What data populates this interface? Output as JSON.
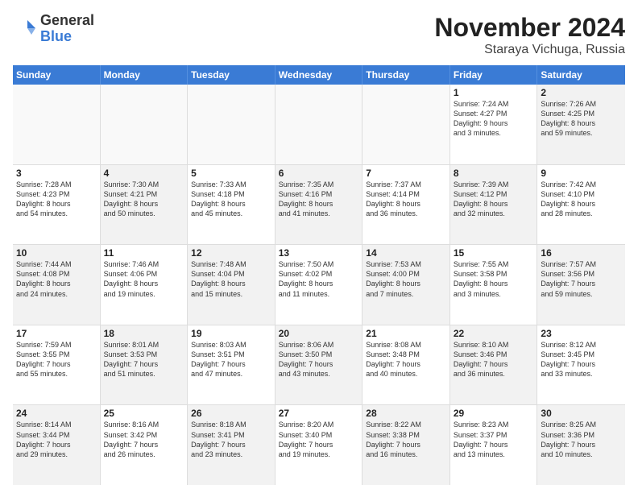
{
  "logo": {
    "general": "General",
    "blue": "Blue"
  },
  "title": "November 2024",
  "subtitle": "Staraya Vichuga, Russia",
  "header_days": [
    "Sunday",
    "Monday",
    "Tuesday",
    "Wednesday",
    "Thursday",
    "Friday",
    "Saturday"
  ],
  "weeks": [
    [
      {
        "day": "",
        "text": "",
        "shaded": true,
        "empty": true
      },
      {
        "day": "",
        "text": "",
        "shaded": true,
        "empty": true
      },
      {
        "day": "",
        "text": "",
        "shaded": true,
        "empty": true
      },
      {
        "day": "",
        "text": "",
        "shaded": true,
        "empty": true
      },
      {
        "day": "",
        "text": "",
        "shaded": true,
        "empty": true
      },
      {
        "day": "1",
        "text": "Sunrise: 7:24 AM\nSunset: 4:27 PM\nDaylight: 9 hours\nand 3 minutes.",
        "shaded": false
      },
      {
        "day": "2",
        "text": "Sunrise: 7:26 AM\nSunset: 4:25 PM\nDaylight: 8 hours\nand 59 minutes.",
        "shaded": true
      }
    ],
    [
      {
        "day": "3",
        "text": "Sunrise: 7:28 AM\nSunset: 4:23 PM\nDaylight: 8 hours\nand 54 minutes.",
        "shaded": false
      },
      {
        "day": "4",
        "text": "Sunrise: 7:30 AM\nSunset: 4:21 PM\nDaylight: 8 hours\nand 50 minutes.",
        "shaded": true
      },
      {
        "day": "5",
        "text": "Sunrise: 7:33 AM\nSunset: 4:18 PM\nDaylight: 8 hours\nand 45 minutes.",
        "shaded": false
      },
      {
        "day": "6",
        "text": "Sunrise: 7:35 AM\nSunset: 4:16 PM\nDaylight: 8 hours\nand 41 minutes.",
        "shaded": true
      },
      {
        "day": "7",
        "text": "Sunrise: 7:37 AM\nSunset: 4:14 PM\nDaylight: 8 hours\nand 36 minutes.",
        "shaded": false
      },
      {
        "day": "8",
        "text": "Sunrise: 7:39 AM\nSunset: 4:12 PM\nDaylight: 8 hours\nand 32 minutes.",
        "shaded": true
      },
      {
        "day": "9",
        "text": "Sunrise: 7:42 AM\nSunset: 4:10 PM\nDaylight: 8 hours\nand 28 minutes.",
        "shaded": false
      }
    ],
    [
      {
        "day": "10",
        "text": "Sunrise: 7:44 AM\nSunset: 4:08 PM\nDaylight: 8 hours\nand 24 minutes.",
        "shaded": true
      },
      {
        "day": "11",
        "text": "Sunrise: 7:46 AM\nSunset: 4:06 PM\nDaylight: 8 hours\nand 19 minutes.",
        "shaded": false
      },
      {
        "day": "12",
        "text": "Sunrise: 7:48 AM\nSunset: 4:04 PM\nDaylight: 8 hours\nand 15 minutes.",
        "shaded": true
      },
      {
        "day": "13",
        "text": "Sunrise: 7:50 AM\nSunset: 4:02 PM\nDaylight: 8 hours\nand 11 minutes.",
        "shaded": false
      },
      {
        "day": "14",
        "text": "Sunrise: 7:53 AM\nSunset: 4:00 PM\nDaylight: 8 hours\nand 7 minutes.",
        "shaded": true
      },
      {
        "day": "15",
        "text": "Sunrise: 7:55 AM\nSunset: 3:58 PM\nDaylight: 8 hours\nand 3 minutes.",
        "shaded": false
      },
      {
        "day": "16",
        "text": "Sunrise: 7:57 AM\nSunset: 3:56 PM\nDaylight: 7 hours\nand 59 minutes.",
        "shaded": true
      }
    ],
    [
      {
        "day": "17",
        "text": "Sunrise: 7:59 AM\nSunset: 3:55 PM\nDaylight: 7 hours\nand 55 minutes.",
        "shaded": false
      },
      {
        "day": "18",
        "text": "Sunrise: 8:01 AM\nSunset: 3:53 PM\nDaylight: 7 hours\nand 51 minutes.",
        "shaded": true
      },
      {
        "day": "19",
        "text": "Sunrise: 8:03 AM\nSunset: 3:51 PM\nDaylight: 7 hours\nand 47 minutes.",
        "shaded": false
      },
      {
        "day": "20",
        "text": "Sunrise: 8:06 AM\nSunset: 3:50 PM\nDaylight: 7 hours\nand 43 minutes.",
        "shaded": true
      },
      {
        "day": "21",
        "text": "Sunrise: 8:08 AM\nSunset: 3:48 PM\nDaylight: 7 hours\nand 40 minutes.",
        "shaded": false
      },
      {
        "day": "22",
        "text": "Sunrise: 8:10 AM\nSunset: 3:46 PM\nDaylight: 7 hours\nand 36 minutes.",
        "shaded": true
      },
      {
        "day": "23",
        "text": "Sunrise: 8:12 AM\nSunset: 3:45 PM\nDaylight: 7 hours\nand 33 minutes.",
        "shaded": false
      }
    ],
    [
      {
        "day": "24",
        "text": "Sunrise: 8:14 AM\nSunset: 3:44 PM\nDaylight: 7 hours\nand 29 minutes.",
        "shaded": true
      },
      {
        "day": "25",
        "text": "Sunrise: 8:16 AM\nSunset: 3:42 PM\nDaylight: 7 hours\nand 26 minutes.",
        "shaded": false
      },
      {
        "day": "26",
        "text": "Sunrise: 8:18 AM\nSunset: 3:41 PM\nDaylight: 7 hours\nand 23 minutes.",
        "shaded": true
      },
      {
        "day": "27",
        "text": "Sunrise: 8:20 AM\nSunset: 3:40 PM\nDaylight: 7 hours\nand 19 minutes.",
        "shaded": false
      },
      {
        "day": "28",
        "text": "Sunrise: 8:22 AM\nSunset: 3:38 PM\nDaylight: 7 hours\nand 16 minutes.",
        "shaded": true
      },
      {
        "day": "29",
        "text": "Sunrise: 8:23 AM\nSunset: 3:37 PM\nDaylight: 7 hours\nand 13 minutes.",
        "shaded": false
      },
      {
        "day": "30",
        "text": "Sunrise: 8:25 AM\nSunset: 3:36 PM\nDaylight: 7 hours\nand 10 minutes.",
        "shaded": true
      }
    ]
  ]
}
